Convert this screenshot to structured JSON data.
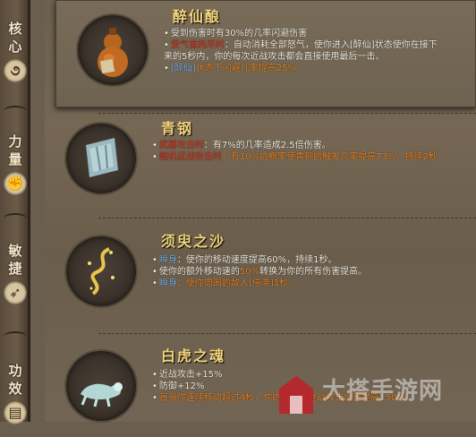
{
  "sidebar": {
    "groups": [
      {
        "label_1": "核",
        "label_2": "心",
        "icon": "swirl-icon"
      },
      {
        "label_1": "力",
        "label_2": "量",
        "icon": "fist-icon"
      },
      {
        "label_1": "敏",
        "label_2": "捷",
        "icon": "feather-icon"
      },
      {
        "label_1": "功",
        "label_2": "效",
        "icon": "book-icon"
      }
    ]
  },
  "items": [
    {
      "name": "醉仙酿",
      "icon": "gourd-icon",
      "lines": [
        {
          "segments": [
            {
              "text": "受到伤害时有30%的几率闪避伤害",
              "color": "white"
            }
          ]
        },
        {
          "segments": [
            {
              "text": "受气值耗尽时",
              "color": "red"
            },
            {
              "text": "：自动消耗全部怒气，使你进入[醉仙]状态使你在接下",
              "color": "white"
            }
          ]
        },
        {
          "segments": [
            {
              "text": "来的5秒内，你的每次近战攻击都会直接使用最后一击。",
              "color": "white"
            }
          ],
          "indent": true
        },
        {
          "segments": [
            {
              "text": "[醉仙]",
              "color": "blue"
            },
            {
              "text": "状态下闪避几率提高25%",
              "color": "orange"
            }
          ]
        }
      ]
    },
    {
      "name": "青钢",
      "icon": "steel-shard-icon",
      "lines": [
        {
          "segments": [
            {
              "text": "武器攻击时",
              "color": "red"
            },
            {
              "text": "：有7%的几率造成2.5倍伤害。",
              "color": "white"
            }
          ]
        },
        {
          "segments": [
            {
              "text": "随机近战攻击时",
              "color": "red"
            },
            {
              "text": "：有10%的概率使青钢的触发几率提高73%，持续2秒",
              "color": "orange"
            }
          ]
        }
      ]
    },
    {
      "name": "须臾之沙",
      "icon": "sand-swirl-icon",
      "lines": [
        {
          "segments": [
            {
              "text": "瞬身",
              "color": "blue"
            },
            {
              "text": "：使你的移动速度提高60%，持续1秒。",
              "color": "white"
            }
          ]
        },
        {
          "segments": [
            {
              "text": "使你的额外移动速的",
              "color": "white"
            },
            {
              "text": "50%",
              "color": "orange"
            },
            {
              "text": "转换为你的所有伤害提高。",
              "color": "white"
            }
          ]
        },
        {
          "segments": [
            {
              "text": "瞬身",
              "color": "blue"
            },
            {
              "text": "：使你周围的敌人[停滞]1秒。",
              "color": "orange"
            }
          ]
        }
      ]
    },
    {
      "name": "白虎之魂",
      "icon": "white-tiger-icon",
      "lines": [
        {
          "segments": [
            {
              "text": "近战攻击+15%",
              "color": "white"
            }
          ]
        },
        {
          "segments": [
            {
              "text": "防御+12%",
              "color": "white"
            }
          ]
        },
        {
          "segments": [
            {
              "text": "每当你连续移动超过4秒，你的下一次近战攻击伤害提高150%",
              "color": "orange"
            }
          ]
        }
      ]
    }
  ],
  "watermark": {
    "text": "大搭手游网"
  },
  "colors": {
    "red": "#e03a24",
    "orange": "#e8862a",
    "blue": "#7fb0e0",
    "gold": "#f2d47a"
  }
}
